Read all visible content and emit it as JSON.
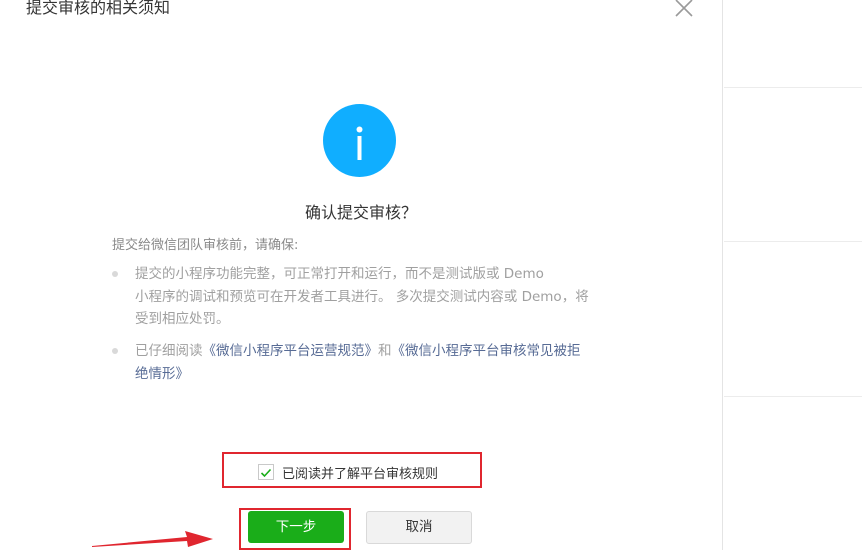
{
  "dialog": {
    "title": "提交审核的相关须知",
    "confirm_title": "确认提交审核？",
    "intro": "提交给微信团队审核前，请确保:",
    "item1_lines": [
      "提交的小程序功能完整，可正常打开和运行，而不是测试版或 Demo",
      "小程序的调试和预览可在开发者工具进行。 多次提交测试内容或 Demo，将",
      "受到相应处罚。"
    ],
    "item2_prefix": "已仔细阅读",
    "item2_link1": "《微信小程序平台运营规范》",
    "item2_and": "和",
    "item2_link2_line1": "《微信小程序平台审核常见被拒",
    "item2_link2_line2": "绝情形》",
    "agree_label": "已阅读并了解平台审核规则",
    "agree_checked": true,
    "next_button": "下一步",
    "cancel_button": "取消"
  },
  "colors": {
    "info_blue": "#10aeff",
    "primary_green": "#1aad19",
    "link_blue": "#576b95",
    "annotation_red": "#e0262f"
  },
  "icons": {
    "close": "close-icon",
    "info": "info-icon",
    "check": "checkmark-icon",
    "arrow": "annotation-arrow-icon"
  }
}
